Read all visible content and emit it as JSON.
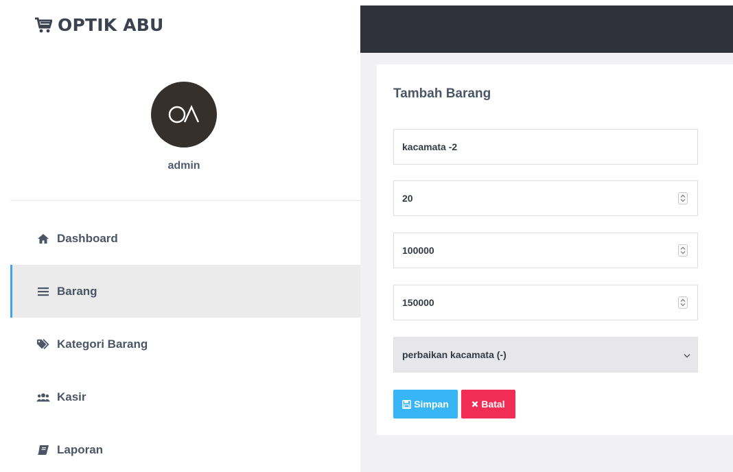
{
  "brand": {
    "title": "OPTIK ABU",
    "icon": "cart-icon"
  },
  "user": {
    "name": "admin",
    "avatar_icon": "logo-avatar"
  },
  "sidebar": {
    "items": [
      {
        "label": "Dashboard",
        "icon": "home-icon",
        "active": false
      },
      {
        "label": "Barang",
        "icon": "bars-icon",
        "active": true
      },
      {
        "label": "Kategori Barang",
        "icon": "tags-icon",
        "active": false
      },
      {
        "label": "Kasir",
        "icon": "users-icon",
        "active": false
      },
      {
        "label": "Laporan",
        "icon": "book-icon",
        "active": false
      }
    ],
    "active_color": "#3fa3f3"
  },
  "form": {
    "title": "Tambah Barang",
    "nama_barang": "kacamata -2",
    "stok": "20",
    "harga_beli": "100000",
    "harga_jual": "150000",
    "kategori_selected": "perbaikan kacamata (-)",
    "save_label": "Simpan",
    "cancel_label": "Batal"
  },
  "colors": {
    "topbar": "#2f323b",
    "save_button": "#37b5f6",
    "cancel_button": "#f22d55"
  }
}
